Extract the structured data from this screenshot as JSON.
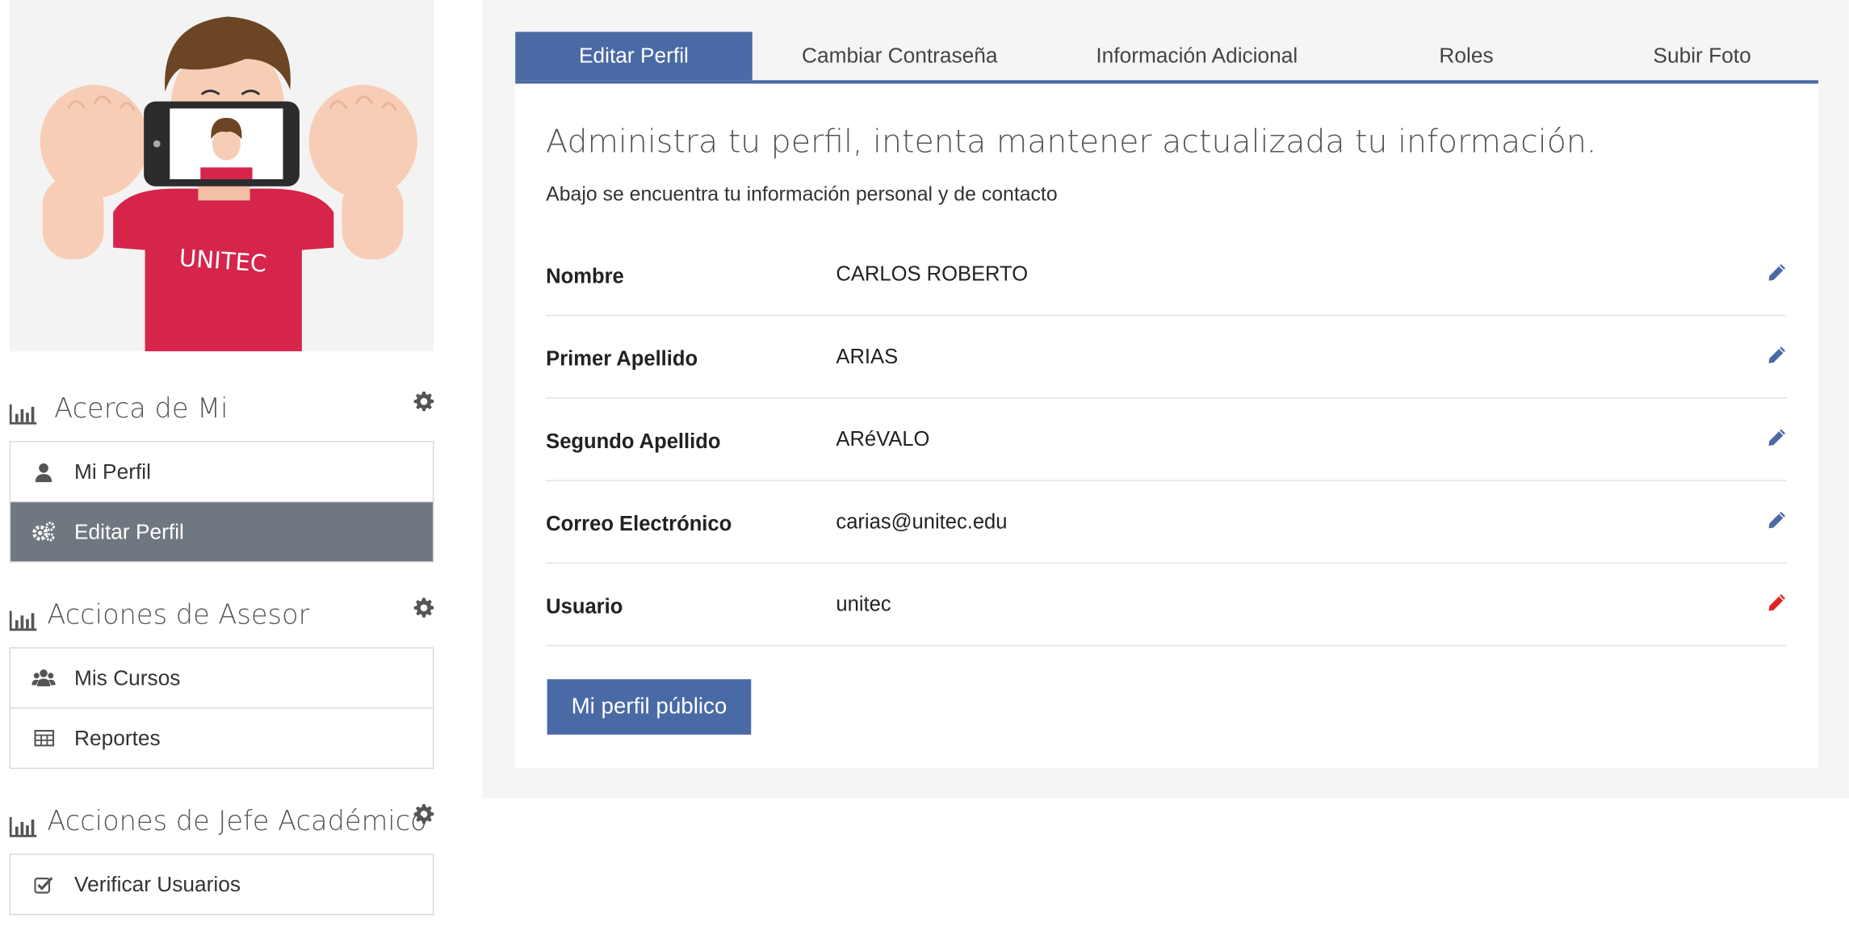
{
  "tabs": [
    {
      "label": "Editar Perfil",
      "active": true
    },
    {
      "label": "Cambiar Contraseña",
      "active": false
    },
    {
      "label": "Información Adicional",
      "active": false
    },
    {
      "label": "Roles",
      "active": false
    },
    {
      "label": "Subir Foto",
      "active": false
    }
  ],
  "sidebar": {
    "avatar_shirt_text": "UNITEC",
    "sections": [
      {
        "title": "Acerca de Mi",
        "items": [
          {
            "label": "Mi Perfil",
            "icon": "user-icon",
            "active": false
          },
          {
            "label": "Editar Perfil",
            "icon": "gears-icon",
            "active": true
          }
        ]
      },
      {
        "title": "Acciones de Asesor",
        "items": [
          {
            "label": "Mis Cursos",
            "icon": "users-icon",
            "active": false
          },
          {
            "label": "Reportes",
            "icon": "table-icon",
            "active": false
          }
        ]
      },
      {
        "title": "Acciones de Jefe Académico",
        "items": [
          {
            "label": "Verificar Usuarios",
            "icon": "checkbox-icon",
            "active": false
          }
        ]
      }
    ]
  },
  "main": {
    "headline": "Administra tu perfil, intenta mantener actualizada tu información.",
    "subline": "Abajo se encuentra tu información personal y de contacto",
    "fields": [
      {
        "label": "Nombre",
        "value": "CARLOS ROBERTO",
        "editable": true
      },
      {
        "label": "Primer Apellido",
        "value": "ARIAS",
        "editable": true
      },
      {
        "label": "Segundo Apellido",
        "value": "ARéVALO",
        "editable": true
      },
      {
        "label": "Correo Electrónico",
        "value": "carias@unitec.edu",
        "editable": true
      },
      {
        "label": "Usuario",
        "value": "unitec",
        "editable": false
      }
    ],
    "public_profile_button": "Mi perfil público"
  },
  "colors": {
    "primary": "#4a6aa5",
    "active_sidebar": "#6f7780",
    "edit_pencil": "#4a6aa5",
    "locked_pencil": "#e02424",
    "shirt": "#d6244b"
  }
}
